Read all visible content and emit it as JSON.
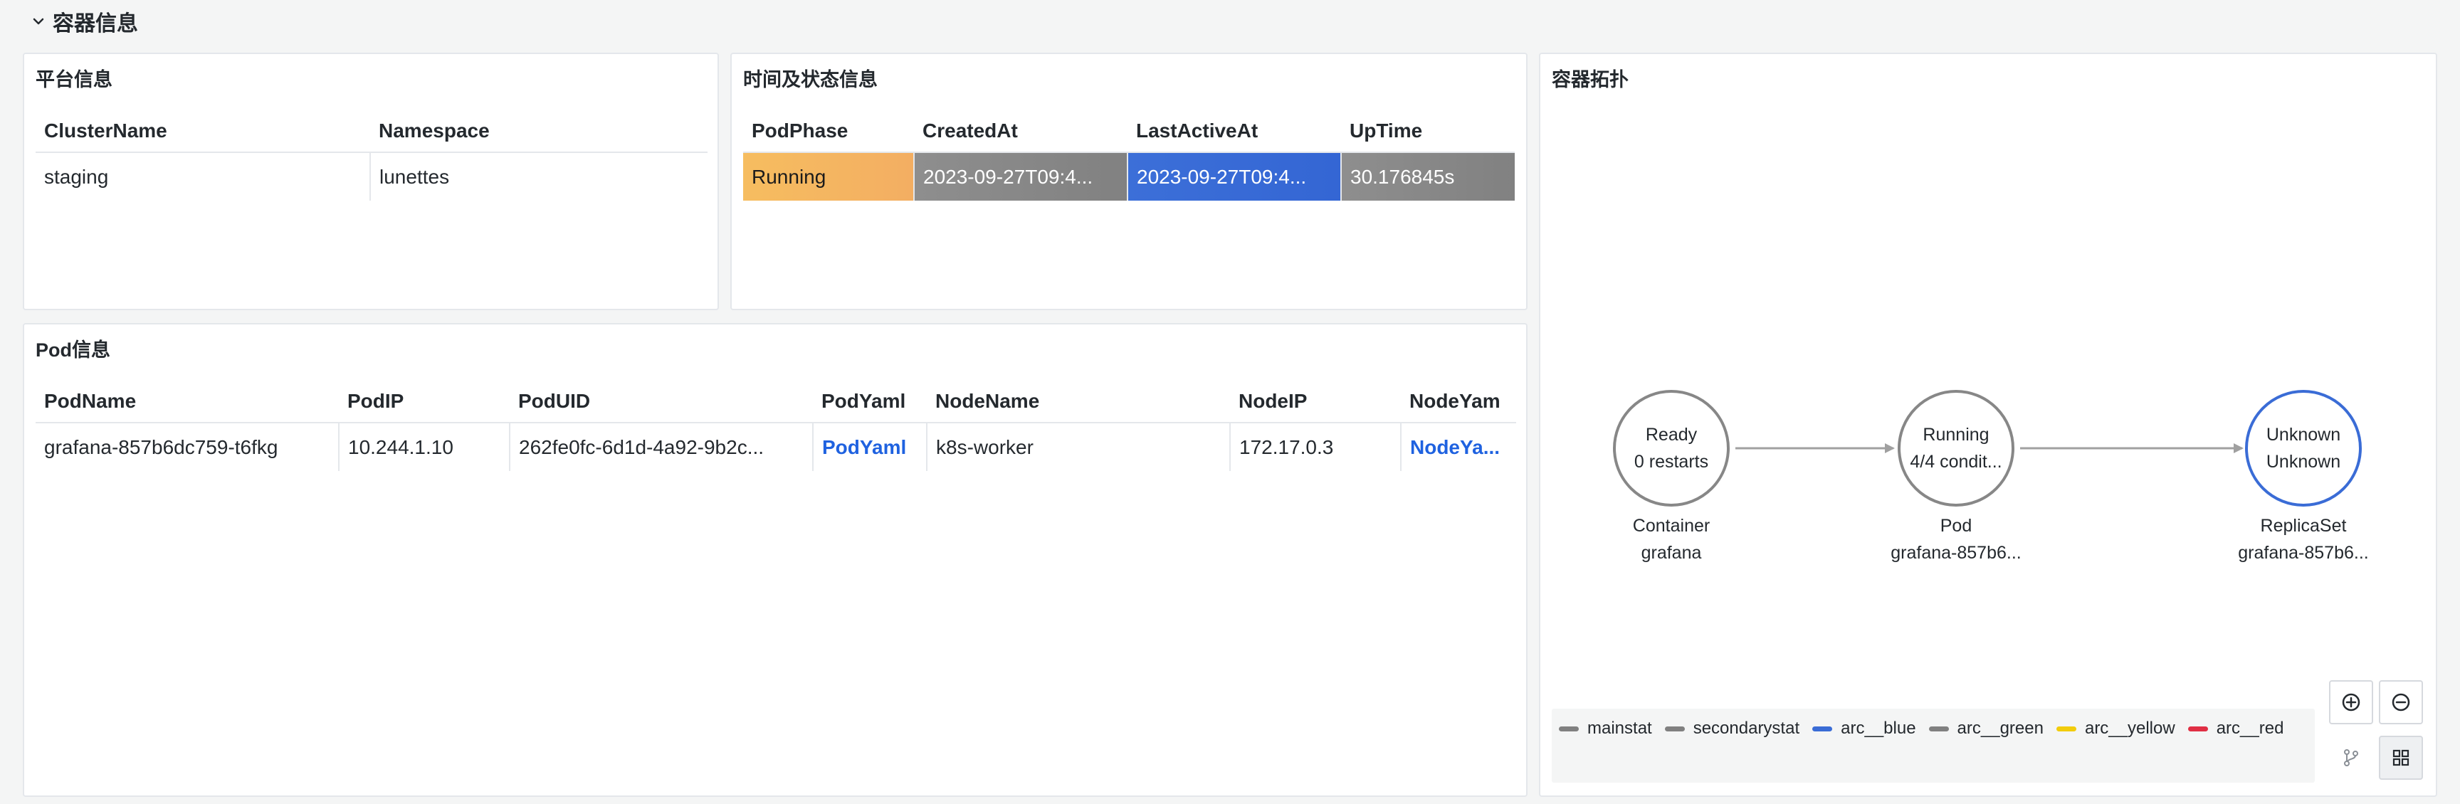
{
  "row": {
    "title": "容器信息"
  },
  "platform": {
    "title": "平台信息",
    "headers": [
      "ClusterName",
      "Namespace"
    ],
    "row": [
      "staging",
      "lunettes"
    ]
  },
  "time_status": {
    "title": "时间及状态信息",
    "headers": [
      "PodPhase",
      "CreatedAt",
      "LastActiveAt",
      "UpTime"
    ],
    "row": [
      "Running",
      "2023-09-27T09:4...",
      "2023-09-27T09:4...",
      "30.176845s"
    ],
    "colors": {
      "phase": "#f4b561",
      "created": "#878787",
      "last_active": "#3a6cd6",
      "uptime": "#878787"
    }
  },
  "pod": {
    "title": "Pod信息",
    "headers": [
      "PodName",
      "PodIP",
      "PodUID",
      "PodYaml",
      "NodeName",
      "NodeIP",
      "NodeYam"
    ],
    "row": [
      "grafana-857b6dc759-t6fkg",
      "10.244.1.10",
      "262fe0fc-6d1d-4a92-9b2c...",
      "PodYaml",
      "k8s-worker",
      "172.17.0.3",
      "NodeYa..."
    ]
  },
  "topology": {
    "title": "容器拓扑",
    "nodes": [
      {
        "main": "Ready",
        "secondary": "0 restarts",
        "kind": "Container",
        "name": "grafana",
        "ring": "#878787"
      },
      {
        "main": "Running",
        "secondary": "4/4 condit...",
        "kind": "Pod",
        "name": "grafana-857b6...",
        "ring": "#878787"
      },
      {
        "main": "Unknown",
        "secondary": "Unknown",
        "kind": "ReplicaSet",
        "name": "grafana-857b6...",
        "ring": "#3a6cd6"
      }
    ],
    "legend": [
      {
        "label": "mainstat",
        "color": "#808080"
      },
      {
        "label": "secondarystat",
        "color": "#808080"
      },
      {
        "label": "arc__blue",
        "color": "#3a6cd6"
      },
      {
        "label": "arc__green",
        "color": "#808080"
      },
      {
        "label": "arc__yellow",
        "color": "#f2cc0c"
      },
      {
        "label": "arc__red",
        "color": "#e02f44"
      }
    ]
  }
}
